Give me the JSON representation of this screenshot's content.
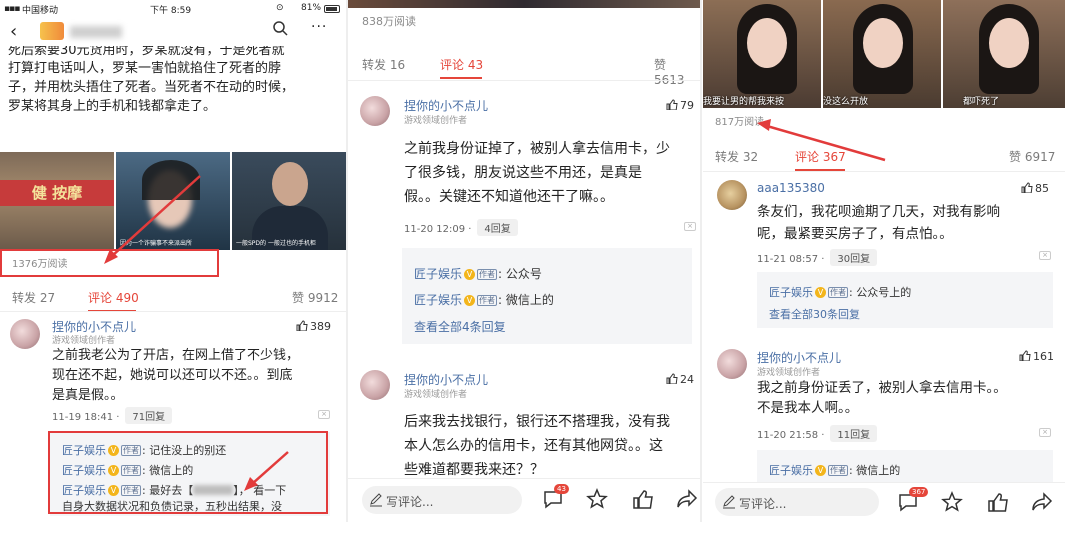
{
  "panel1": {
    "status": {
      "carrier": "中国移动",
      "time": "下午 8:59",
      "battery": "81%"
    },
    "article_lines": [
      "死后索要30元货用时，罗某就没有，于是死者就",
      "打算打电话叫人，罗某一害怕就掐住了死者的脖",
      "子，并用枕头捂住了死者。当死者不在动的时候，",
      "罗某将其身上的手机和钱都拿走了。"
    ],
    "photo_caption_1": "因为一个诈骗事不来派出所",
    "photo_caption_2": "一般SPD的 一般过也的手机柜",
    "shop_sign": "健 按摩",
    "reads": "1376万阅读",
    "tabs": {
      "repost": "转发 27",
      "comments": "评论 490",
      "likes": "赞 9912"
    },
    "comment": {
      "user": "捏你的小不点儿",
      "role": "游戏领域创作者",
      "likes": "389",
      "text_lines": [
        "之前我老公为了开店，在网上借了不少钱，",
        "现在还不起，她说可以还可以不还。。到底",
        "是真是假。。"
      ],
      "time": "11-19 18:41 ·",
      "reply_count": "71回复"
    },
    "replies": [
      {
        "name": "匠子娱乐",
        "tag": "作者",
        "text": ": 记住没上的别还"
      },
      {
        "name": "匠子娱乐",
        "tag": "作者",
        "text": ": 微信上的"
      },
      {
        "name": "匠子娱乐",
        "tag": "作者",
        "text": ": 最好去【",
        "text2": "】，  看一下"
      }
    ],
    "reply_cont": "自身大数据状况和负债记录，五秒出结果，没"
  },
  "panel2": {
    "reads": "838万阅读",
    "tabs": {
      "repost": "转发 16",
      "comments": "评论 43",
      "likes": "赞 5613"
    },
    "comment1": {
      "user": "捏你的小不点儿",
      "role": "游戏领域创作者",
      "likes": "79",
      "text_lines": [
        "之前我身份证掉了，被别人拿去信用卡，少",
        "了很多钱，朋友说这些不用还，是真是",
        "假。。关键还不知道他还干了嘛。。"
      ],
      "time": "11-20 12:09 ·",
      "reply_count": "4回复"
    },
    "replies": [
      {
        "name": "匠子娱乐",
        "tag": "作者",
        "text": ": 公众号"
      },
      {
        "name": "匠子娱乐",
        "tag": "作者",
        "text": ": 微信上的"
      }
    ],
    "see_all": "查看全部4条回复",
    "comment2": {
      "user": "捏你的小不点儿",
      "role": "游戏领域创作者",
      "likes": "24",
      "text_lines": [
        "后来我去找银行，银行还不搭理我，没有我",
        "本人怎么办的信用卡，还有其他网贷。。这",
        "些难道都要我来还？？"
      ]
    },
    "write": "写评论...",
    "comment_badge": "43"
  },
  "panel3": {
    "video_captions": [
      "我要让男的帮我来按",
      "没这么开放",
      "都吓死了"
    ],
    "reads": "817万阅读",
    "tabs": {
      "repost": "转发 32",
      "comments": "评论 367",
      "likes": "赞 6917"
    },
    "comment1": {
      "user": "aaa135380",
      "likes": "85",
      "text_lines": [
        "条友们，我花呗逾期了几天，对我有影响",
        "呢，最紧要买房子了，有点怕。。"
      ],
      "time": "11-21 08:57 ·",
      "reply_count": "30回复"
    },
    "replies": [
      {
        "name": "匠子娱乐",
        "tag": "作者",
        "text": ": 公众号上的"
      }
    ],
    "see_all": "查看全部30条回复",
    "comment2": {
      "user": "捏你的小不点儿",
      "role": "游戏领域创作者",
      "likes": "161",
      "text_lines": [
        "我之前身份证丢了，被别人拿去信用卡。。",
        "不是我本人啊。。"
      ],
      "time": "11-20 21:58 ·",
      "reply_count": "11回复"
    },
    "replies2": [
      {
        "name": "匠子娱乐",
        "tag": "作者",
        "text": ": 微信上的"
      }
    ],
    "write": "写评论...",
    "comment_badge": "367"
  },
  "colors": {
    "accent_red": "#e5463a",
    "link_blue": "#4a6fa5",
    "annotation_red": "#e23b3b"
  }
}
